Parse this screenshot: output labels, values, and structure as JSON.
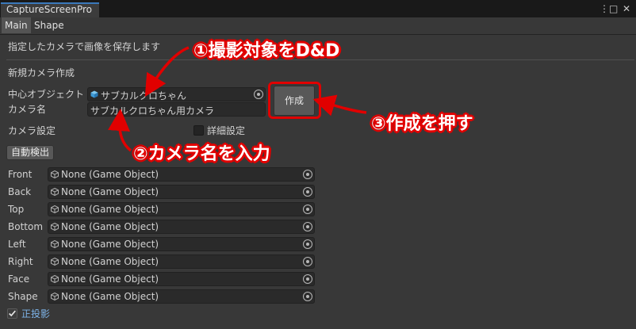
{
  "window": {
    "title": "CaptureScreenPro",
    "menu_icon": "⋮",
    "maximize_icon": "□",
    "close_icon": "✕"
  },
  "tabs": [
    {
      "label": "Main",
      "active": true
    },
    {
      "label": "Shape",
      "active": false
    }
  ],
  "description": "指定したカメラで画像を保存します",
  "new_camera": {
    "section_label": "新規カメラ作成",
    "center_object_label": "中心オブジェクト",
    "center_object_value": "サブカルクロちゃん",
    "camera_name_label": "カメラ名",
    "camera_name_value": "サブカルクロちゃん用カメラ",
    "create_button": "作成"
  },
  "camera_settings": {
    "section_label": "カメラ設定",
    "detail_label": "詳細設定",
    "detail_checked": false,
    "auto_detect_button": "自動検出",
    "rows": [
      {
        "label": "Front",
        "value": "None (Game Object)"
      },
      {
        "label": "Back",
        "value": "None (Game Object)"
      },
      {
        "label": "Top",
        "value": "None (Game Object)"
      },
      {
        "label": "Bottom",
        "value": "None (Game Object)"
      },
      {
        "label": "Left",
        "value": "None (Game Object)"
      },
      {
        "label": "Right",
        "value": "None (Game Object)"
      },
      {
        "label": "Face",
        "value": "None (Game Object)"
      },
      {
        "label": "Shape",
        "value": "None (Game Object)"
      }
    ],
    "orthographic_label": "正投影",
    "orthographic_checked": true
  },
  "annotations": {
    "step1": "①撮影対象をD&D",
    "step2": "②カメラ名を入力",
    "step3": "③作成を押す",
    "color": "#e10000"
  },
  "colors": {
    "background": "#383838",
    "field": "#2a2a2a",
    "accent": "#3a79bb",
    "annotation": "#e10000"
  }
}
